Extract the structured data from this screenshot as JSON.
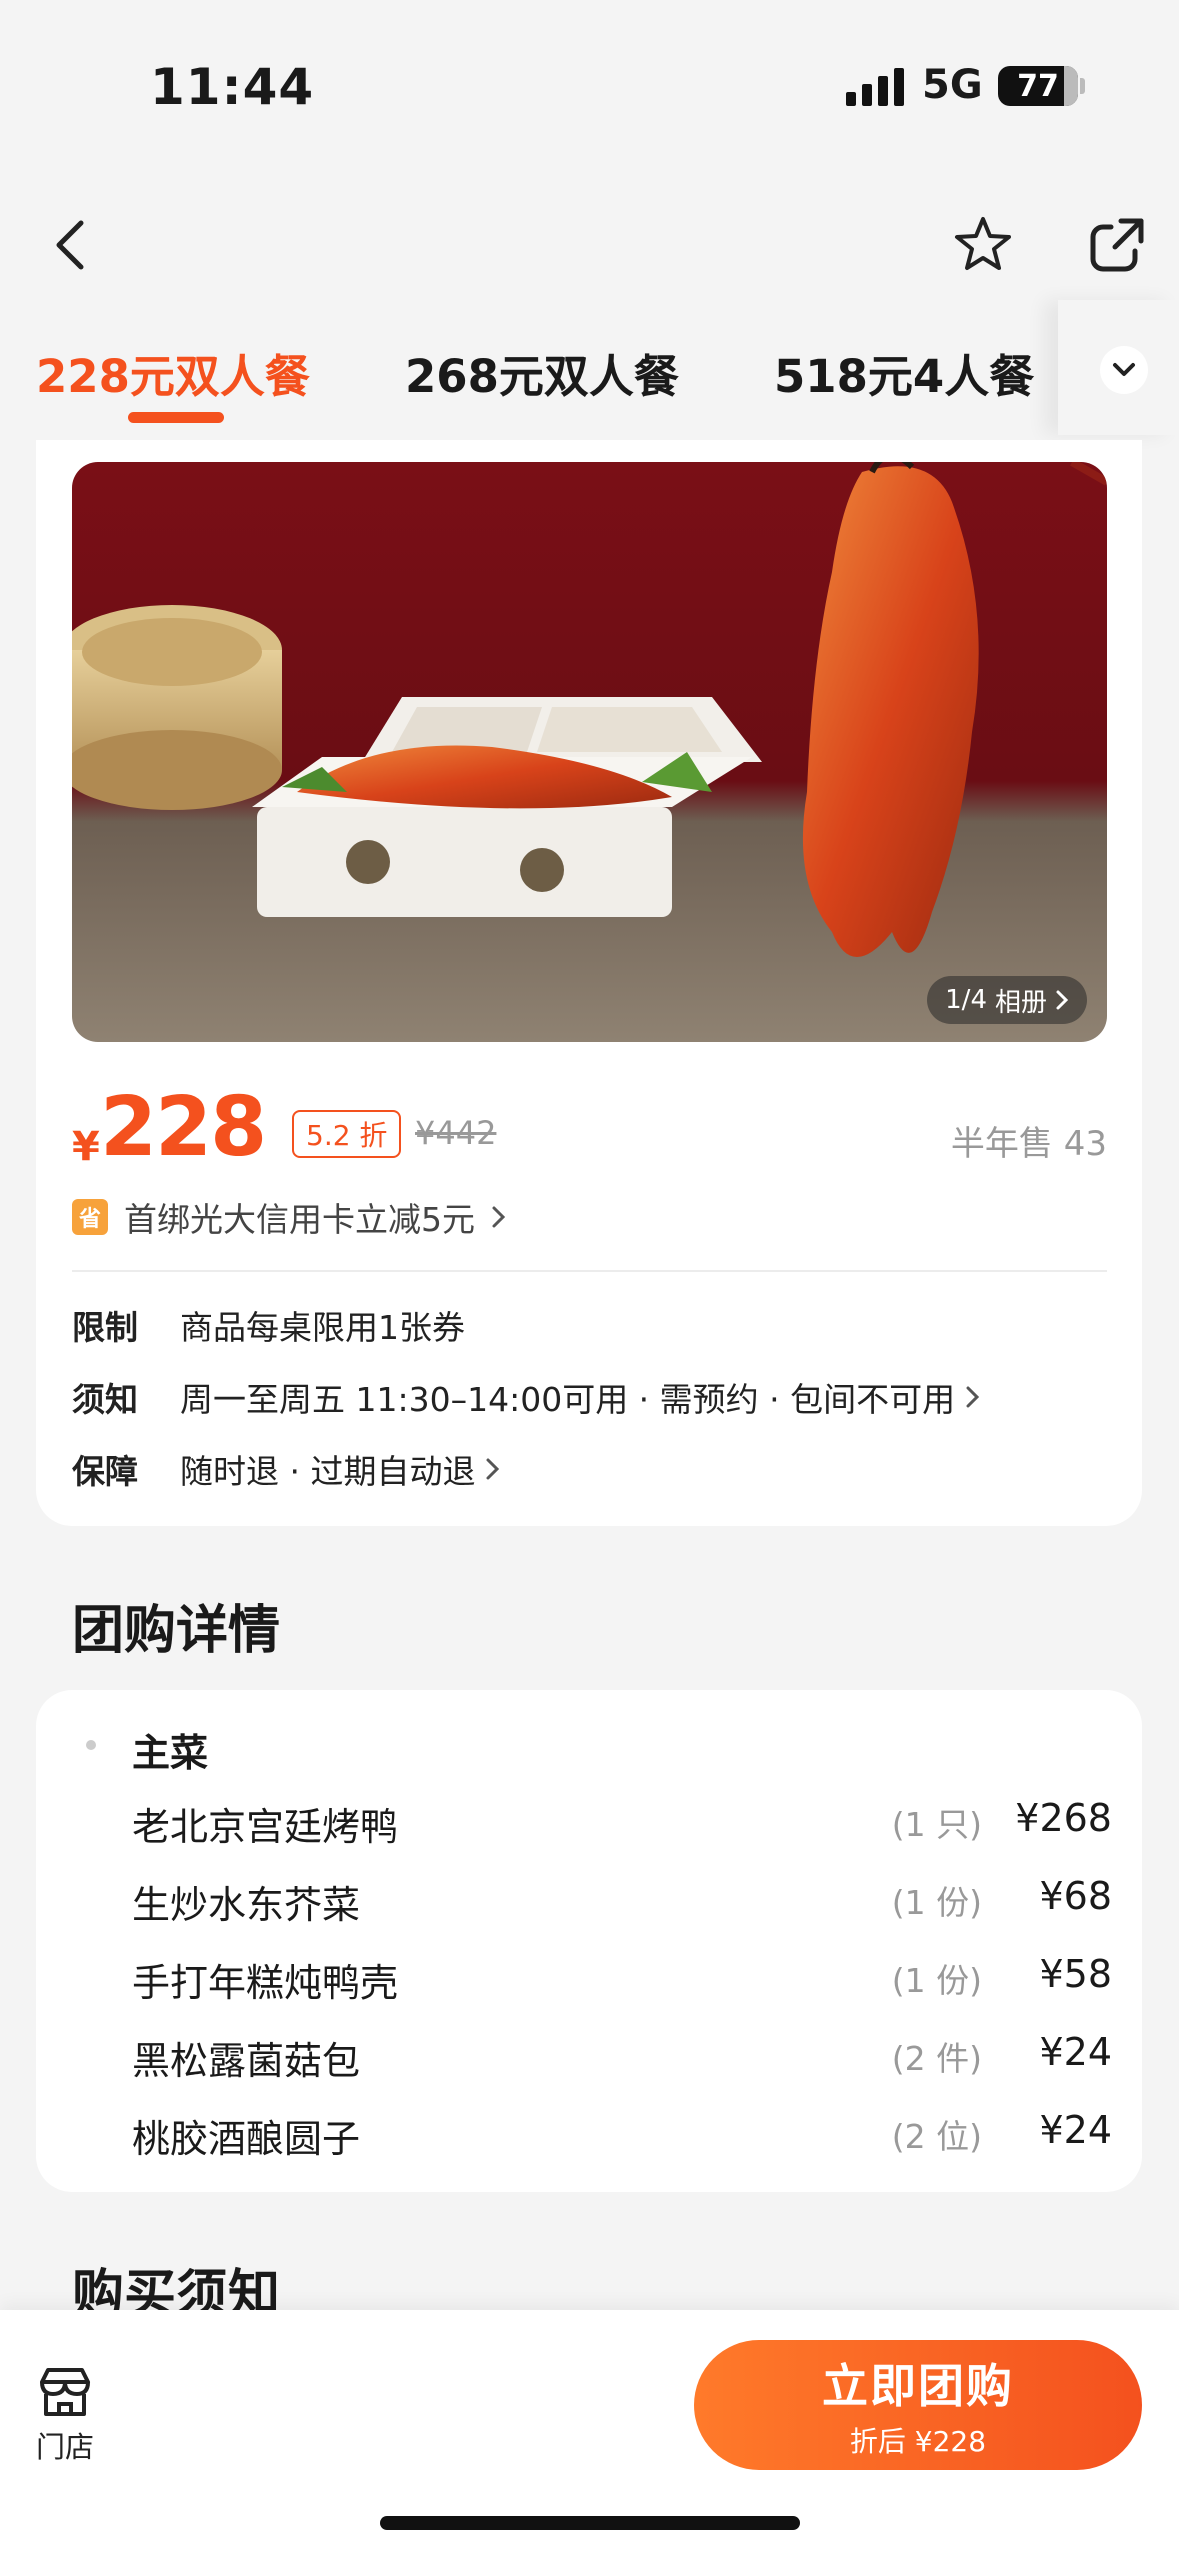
{
  "status": {
    "time": "11:44",
    "network": "5G",
    "battery": "77"
  },
  "tabs": [
    {
      "label": "228元双人餐",
      "active": true
    },
    {
      "label": "268元双人餐",
      "active": false
    },
    {
      "label": "518元4人餐",
      "active": false
    }
  ],
  "hero": {
    "counter": "1/4",
    "album_label": "相册"
  },
  "price": {
    "currency": "¥",
    "value": "228",
    "discount": "5.2 折",
    "original": "¥442",
    "sold": "半年售 43"
  },
  "promo": {
    "icon_text": "省",
    "text": "首绑光大信用卡立减5元"
  },
  "info": [
    {
      "label": "限制",
      "text": "商品每桌限用1张券"
    },
    {
      "label": "须知",
      "text": "周一至周五 11:30–14:00可用 · 需预约 · 包间不可用"
    },
    {
      "label": "保障",
      "text": "随时退 · 过期自动退"
    }
  ],
  "details": {
    "title": "团购详情",
    "category": "主菜",
    "items": [
      {
        "name": "老北京宫廷烤鸭",
        "qty": "(1 只)",
        "price": "¥268"
      },
      {
        "name": "生炒水东芥菜",
        "qty": "(1 份)",
        "price": "¥68"
      },
      {
        "name": "手打年糕炖鸭壳",
        "qty": "(1 份)",
        "price": "¥58"
      },
      {
        "name": "黑松露菌菇包",
        "qty": "(2 件)",
        "price": "¥24"
      },
      {
        "name": "桃胶酒酿圆子",
        "qty": "(2 位)",
        "price": "¥24"
      }
    ]
  },
  "notice_title": "购买须知",
  "bottom": {
    "store_label": "门店",
    "buy_label": "立即团购",
    "buy_sub": "折后 ¥228"
  },
  "colors": {
    "accent": "#f4511e",
    "background": "#f4f4f4"
  }
}
